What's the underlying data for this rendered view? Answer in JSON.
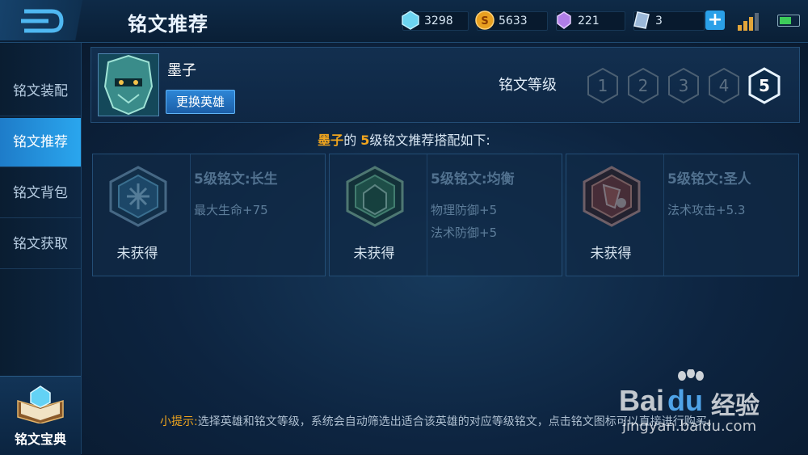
{
  "header": {
    "title": "铭文推荐",
    "resources": [
      {
        "name": "diamond-icon",
        "value": "3298",
        "color": "#6cd4f0"
      },
      {
        "name": "gold-coin-icon",
        "value": "5633",
        "color": "#e8a020"
      },
      {
        "name": "gem-icon",
        "value": "221",
        "color": "#b07ee8"
      },
      {
        "name": "ticket-icon",
        "value": "3",
        "color": "#9bb8d8"
      }
    ],
    "plus_label": "+"
  },
  "sidebar": {
    "items": [
      {
        "label": "铭文装配",
        "active": false
      },
      {
        "label": "铭文推荐",
        "active": true
      },
      {
        "label": "铭文背包",
        "active": false
      },
      {
        "label": "铭文获取",
        "active": false
      }
    ],
    "codex_label": "铭文宝典"
  },
  "hero": {
    "name": "墨子",
    "swap_label": "更换英雄",
    "level_label": "铭文等级",
    "levels": [
      "1",
      "2",
      "3",
      "4",
      "5"
    ],
    "selected_level": "5"
  },
  "summary": {
    "hero": "墨子",
    "mid": "的 ",
    "level": "5",
    "rest": "级铭文推荐搭配如下:"
  },
  "runes": [
    {
      "name": "5级铭文:长生",
      "stats": [
        "最大生命+75"
      ],
      "status": "未获得",
      "color": "#3f8fb8"
    },
    {
      "name": "5级铭文:均衡",
      "stats": [
        "物理防御+5",
        "法术防御+5"
      ],
      "status": "未获得",
      "color": "#3a8f5a"
    },
    {
      "name": "5级铭文:圣人",
      "stats": [
        "法术攻击+5.3"
      ],
      "status": "未获得",
      "color": "#b54a3a"
    }
  ],
  "tip": {
    "label": "小提示:",
    "text": "选择英雄和铭文等级，系统会自动筛选出适合该英雄的对应等级铭文，点击铭文图标可以直接进行购买。"
  },
  "watermark": {
    "brand": "Bai",
    "brand2": "du",
    "cn": "经验",
    "url": "jingyan.baidu.com"
  }
}
